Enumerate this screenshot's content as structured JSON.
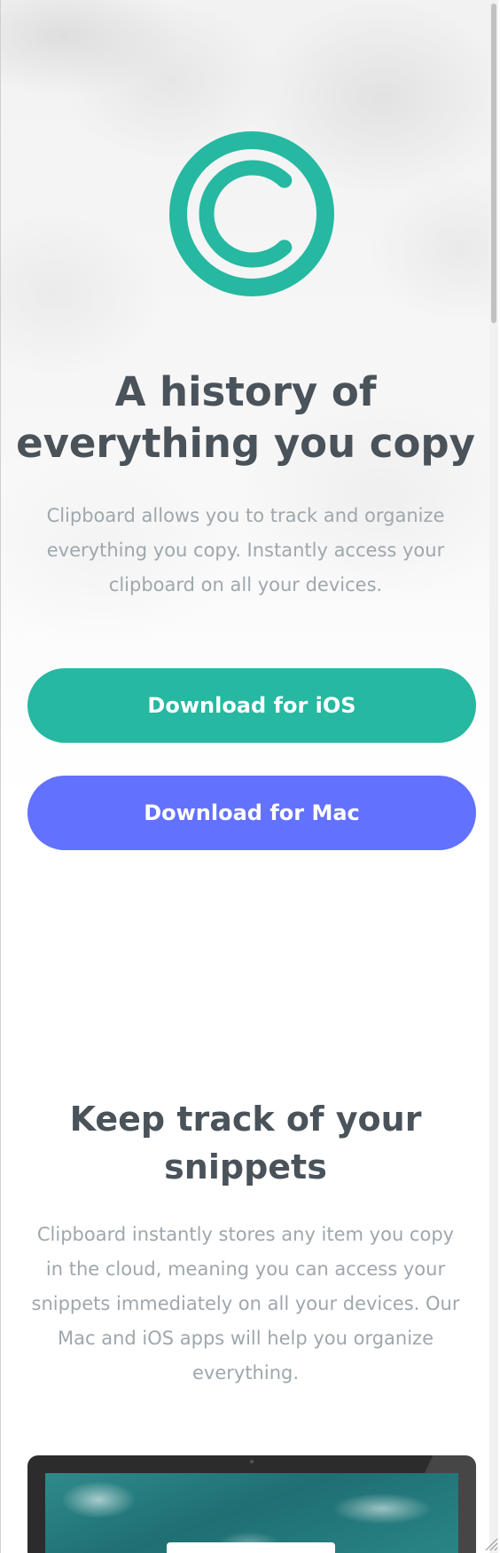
{
  "hero": {
    "logo_icon": "copyright-icon",
    "title": "A history of everything you copy",
    "description": "Clipboard allows you to track and organize everything you copy. Instantly access your clipboard on all your devices.",
    "buttons": {
      "ios": "Download for iOS",
      "mac": "Download for Mac"
    }
  },
  "snippets": {
    "title": "Keep track of your snippets",
    "description": "Clipboard instantly stores any item you copy in the cloud, meaning you can access your snippets immediately on all your devices. Our Mac and iOS apps will help you organize everything.",
    "image": "computer-monitor-image"
  },
  "colors": {
    "accent_teal": "#26b8a1",
    "accent_blue": "#6371ff",
    "heading": "#4a525a",
    "body_text": "#9fa7ac"
  }
}
